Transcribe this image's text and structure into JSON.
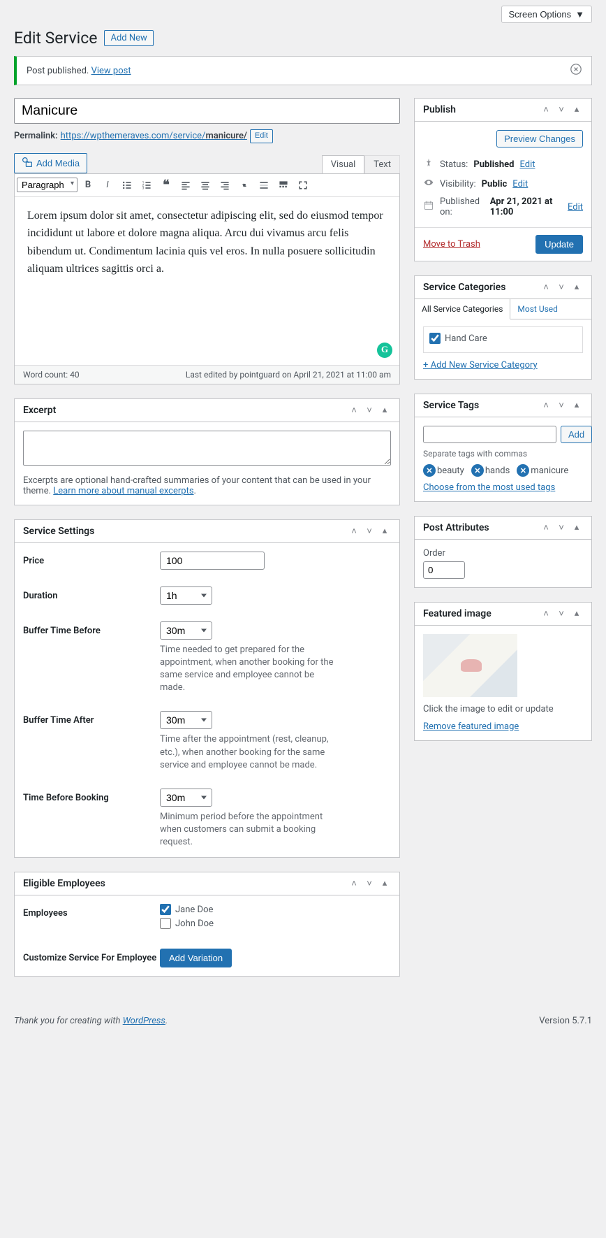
{
  "screen_options": "Screen Options",
  "page_title": "Edit Service",
  "add_new": "Add New",
  "notice": {
    "text": "Post published.",
    "link": "View post"
  },
  "title_value": "Manicure",
  "permalink": {
    "label": "Permalink:",
    "base": "https://wpthemeraves.com/service/",
    "slug": "manicure/",
    "edit": "Edit"
  },
  "add_media": "Add Media",
  "editor_tabs": {
    "visual": "Visual",
    "text": "Text"
  },
  "toolbar": {
    "format": "Paragraph"
  },
  "editor_content": "Lorem ipsum dolor sit amet, consectetur adipiscing elit, sed do eiusmod tempor incididunt ut labore et dolore magna aliqua. Arcu dui vivamus arcu felis bibendum ut. Condimentum lacinia quis vel eros. In nulla posuere sollicitudin aliquam ultrices sagittis orci a.",
  "editor_footer": {
    "wordcount": "Word count: 40",
    "lastedit": "Last edited by pointguard on April 21, 2021 at 11:00 am"
  },
  "excerpt": {
    "title": "Excerpt",
    "help": "Excerpts are optional hand-crafted summaries of your content that can be used in your theme.",
    "link": "Learn more about manual excerpts"
  },
  "service_settings": {
    "title": "Service Settings",
    "price": {
      "label": "Price",
      "value": "100"
    },
    "duration": {
      "label": "Duration",
      "value": "1h"
    },
    "buffer_before": {
      "label": "Buffer Time Before",
      "value": "30m",
      "desc": "Time needed to get prepared for the appointment, when another booking for the same service and employee cannot be made."
    },
    "buffer_after": {
      "label": "Buffer Time After",
      "value": "30m",
      "desc": "Time after the appointment (rest, cleanup, etc.), when another booking for the same service and employee cannot be made."
    },
    "time_before": {
      "label": "Time Before Booking",
      "value": "30m",
      "desc": "Minimum period before the appointment when customers can submit a booking request."
    }
  },
  "eligible": {
    "title": "Eligible Employees",
    "employees_label": "Employees",
    "employees": [
      {
        "name": "Jane Doe",
        "checked": true
      },
      {
        "name": "John Doe",
        "checked": false
      }
    ],
    "customize_label": "Customize Service For Employee",
    "add_variation": "Add Variation"
  },
  "publish": {
    "title": "Publish",
    "preview": "Preview Changes",
    "status": {
      "label": "Status:",
      "value": "Published",
      "edit": "Edit"
    },
    "visibility": {
      "label": "Visibility:",
      "value": "Public",
      "edit": "Edit"
    },
    "published": {
      "label": "Published on:",
      "value": "Apr 21, 2021 at 11:00",
      "edit": "Edit"
    },
    "trash": "Move to Trash",
    "update": "Update"
  },
  "categories": {
    "title": "Service Categories",
    "tab_all": "All Service Categories",
    "tab_most": "Most Used",
    "items": [
      {
        "name": "Hand Care",
        "checked": true
      }
    ],
    "add_new": "+ Add New Service Category"
  },
  "tags": {
    "title": "Service Tags",
    "add": "Add",
    "help": "Separate tags with commas",
    "items": [
      "beauty",
      "hands",
      "manicure"
    ],
    "choose": "Choose from the most used tags"
  },
  "attributes": {
    "title": "Post Attributes",
    "order_label": "Order",
    "order_value": "0"
  },
  "featured": {
    "title": "Featured image",
    "help": "Click the image to edit or update",
    "remove": "Remove featured image"
  },
  "footer": {
    "thanks": "Thank you for creating with",
    "wp": "WordPress",
    "version": "Version 5.7.1"
  }
}
